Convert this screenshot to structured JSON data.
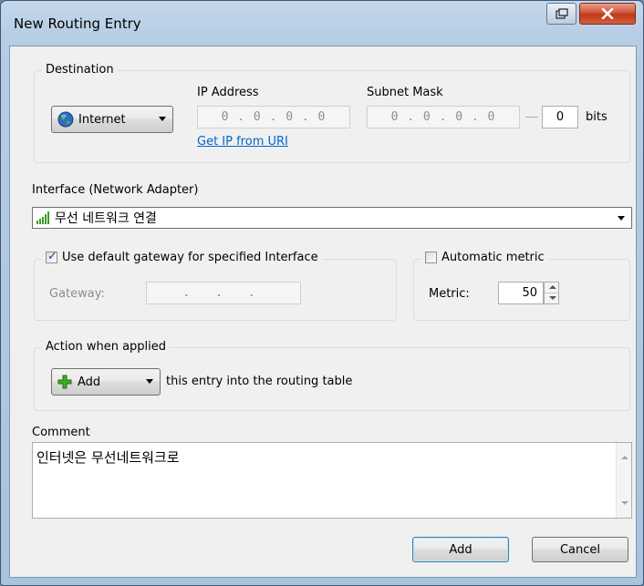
{
  "window": {
    "title": "New Routing Entry"
  },
  "destination": {
    "legend": "Destination",
    "type_selected": "Internet",
    "ip_label": "IP Address",
    "ip_value": "0 . 0 . 0 . 0",
    "subnet_label": "Subnet Mask",
    "subnet_value": "0 . 0 . 0 . 0",
    "bits_value": "0",
    "bits_label": "bits",
    "get_ip_link": "Get IP from URI"
  },
  "interface": {
    "label": "Interface (Network Adapter)",
    "selected": "무선 네트워크 연결"
  },
  "gateway": {
    "legend": "Use default gateway for specified Interface",
    "checked": true,
    "label": "Gateway:",
    "value": ". . ."
  },
  "metric": {
    "legend": "Automatic metric",
    "checked": false,
    "label": "Metric:",
    "value": "50"
  },
  "action": {
    "legend": "Action when applied",
    "selected": "Add",
    "suffix": "this entry into the routing table"
  },
  "comment": {
    "label": "Comment",
    "value": "인터넷은 무선네트워크로"
  },
  "buttons": {
    "add": "Add",
    "cancel": "Cancel"
  },
  "colors": {
    "link": "#0066cc",
    "close_button": "#c9452a",
    "title_bar": "#b7cde4"
  }
}
